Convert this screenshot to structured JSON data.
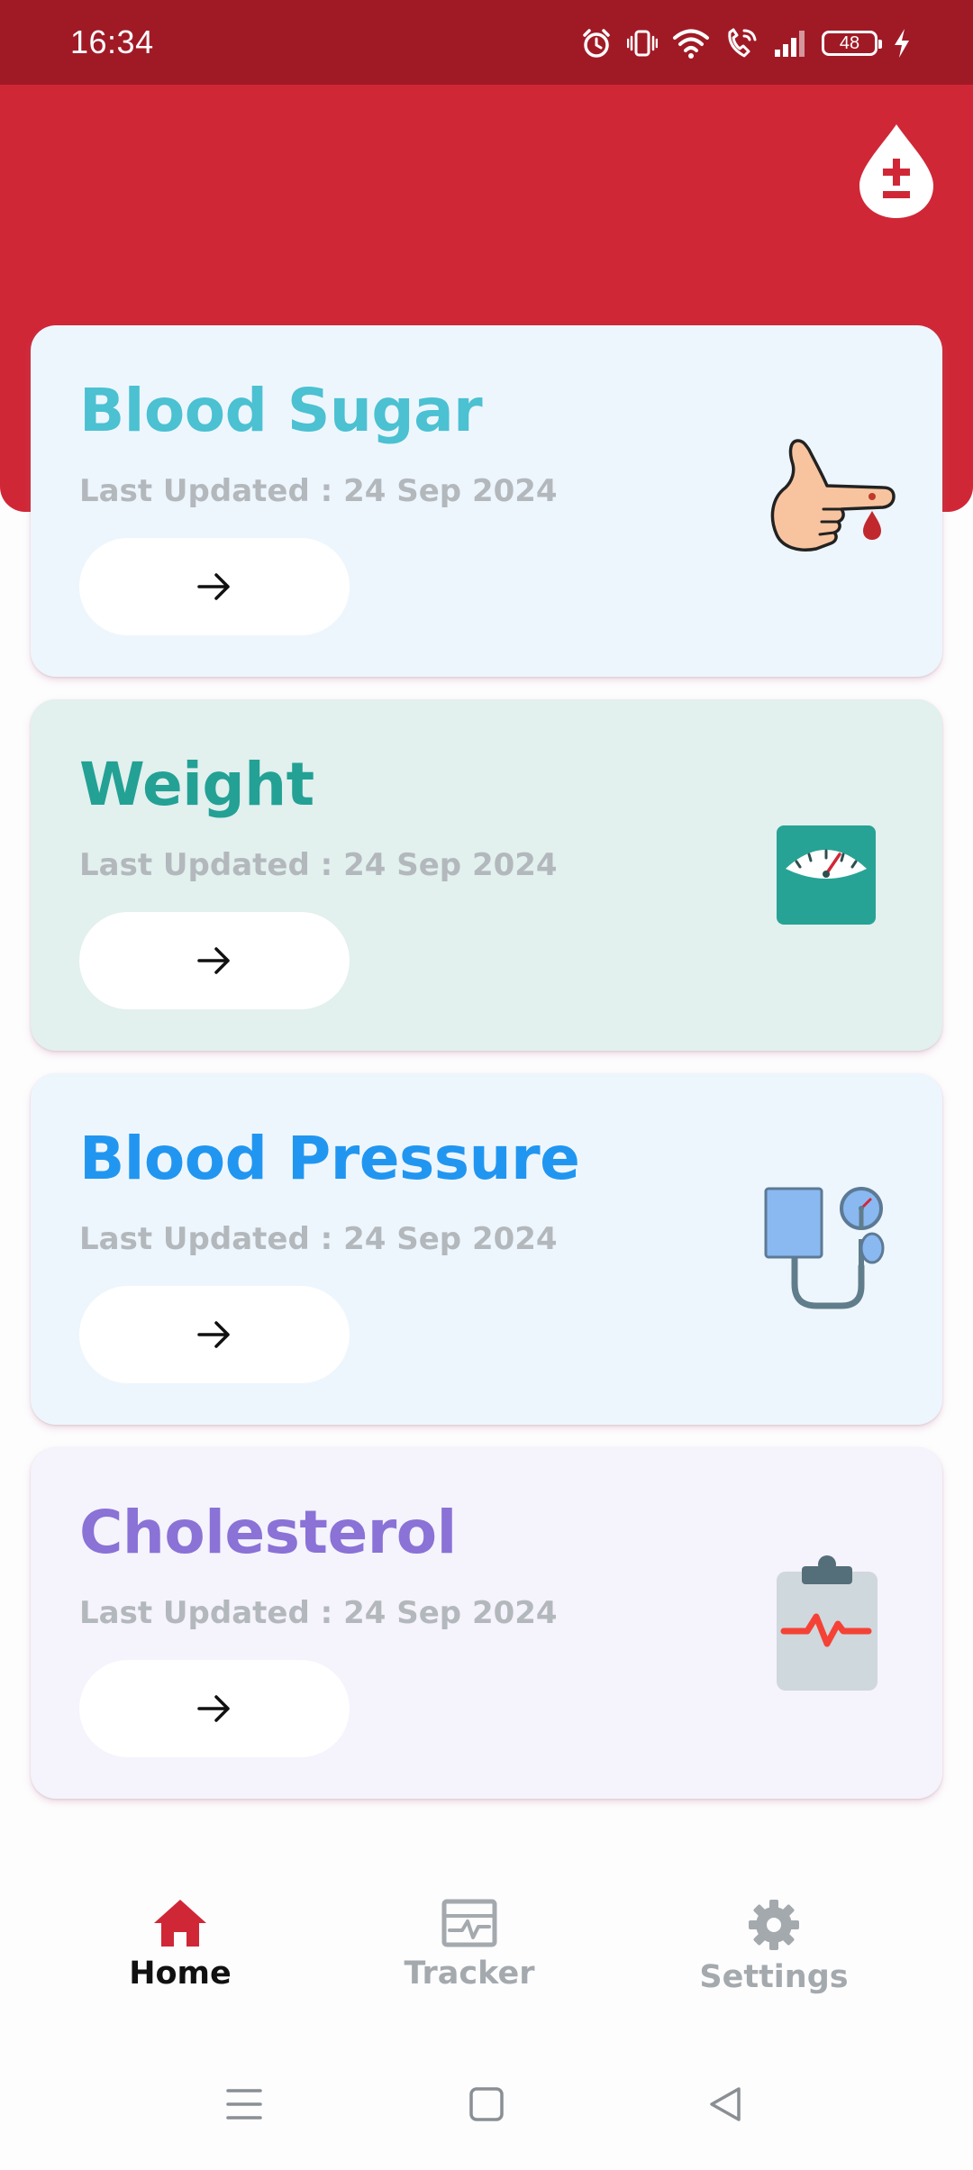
{
  "status_bar": {
    "time": "16:34",
    "battery": "48",
    "icons": [
      "alarm-icon",
      "vibrate-icon",
      "wifi-icon",
      "wifi-call-icon",
      "signal-icon",
      "battery-icon",
      "charging-icon"
    ]
  },
  "header": {
    "logo_icon": "blood-drop-plus-minus-icon"
  },
  "cards": [
    {
      "title": "Blood Sugar",
      "subtitle": "Last Updated : 24 Sep 2024",
      "title_color": "#4bc1d2",
      "background": "#eef6fd",
      "icon": "finger-prick-icon"
    },
    {
      "title": "Weight",
      "subtitle": "Last Updated : 24 Sep 2024",
      "title_color": "#23a195",
      "background": "#e2f0ee",
      "icon": "weight-scale-icon"
    },
    {
      "title": "Blood Pressure",
      "subtitle": "Last Updated : 24 Sep 2024",
      "title_color": "#2196f0",
      "background": "#eef6fd",
      "icon": "blood-pressure-monitor-icon"
    },
    {
      "title": "Cholesterol",
      "subtitle": "Last Updated : 24 Sep 2024",
      "title_color": "#8a72d6",
      "background": "#f5f3fc",
      "icon": "clipboard-heartbeat-icon"
    }
  ],
  "bottom_nav": [
    {
      "label": "Home",
      "icon": "home-icon",
      "active": true
    },
    {
      "label": "Tracker",
      "icon": "tracker-chart-icon",
      "active": false
    },
    {
      "label": "Settings",
      "icon": "gear-icon",
      "active": false
    }
  ],
  "colors": {
    "brand_red": "#d02737",
    "status_bar": "#a01a26",
    "nav_active_icon": "#d02737",
    "nav_active_text": "#111111",
    "nav_inactive": "#a4a9ae"
  }
}
